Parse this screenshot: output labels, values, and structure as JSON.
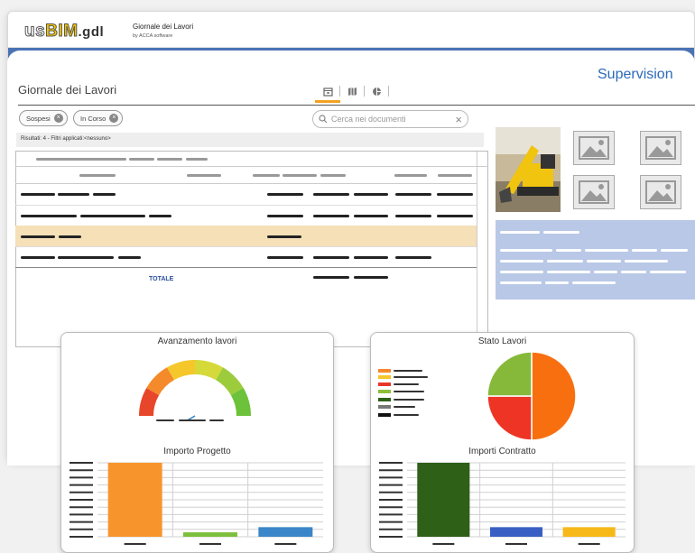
{
  "app": {
    "logo_us": "us",
    "logo_bim": "BIM",
    "logo_gdl": ".gdl",
    "brand_name": "Giornale dei Lavori",
    "brand_sub": "by ACCA software"
  },
  "page": {
    "title": "Giornale dei Lavori",
    "section": "Supervision"
  },
  "tabs": [
    {
      "icon": "calendar-icon",
      "active": true
    },
    {
      "icon": "map-icon",
      "active": false
    },
    {
      "icon": "pie-chart-icon",
      "active": false
    }
  ],
  "filters": {
    "chips": [
      "Sospesi",
      "In Corso"
    ],
    "search_placeholder": "Cerca nei documenti",
    "results_text": "Risultati: 4 - Filtri applicati:<nessuno>"
  },
  "table": {
    "total_label": "TOTALE",
    "highlight_color": "#f5e0b8"
  },
  "cards": {
    "gauge_title": "Avanzamento lavori",
    "stato_title": "Stato Lavori",
    "importo_title": "Importo Progetto",
    "contratti_title": "Importi Contratto"
  },
  "chart_data": [
    {
      "type": "gauge",
      "title": "Avanzamento lavori",
      "value": 0.2,
      "segment_colors": [
        "#e8462a",
        "#f58a2a",
        "#f5c72a",
        "#d6d93a",
        "#9ccc3c",
        "#6cc23a"
      ]
    },
    {
      "type": "pie",
      "title": "Stato Lavori",
      "values": [
        50,
        25,
        25
      ],
      "colors": [
        "#f86f10",
        "#ee3424",
        "#86b93a"
      ]
    },
    {
      "type": "bar",
      "title": "Importo Progetto",
      "values": [
        100,
        6,
        13
      ],
      "colors": [
        "#f7952c",
        "#7cbf3c",
        "#3a86c8"
      ],
      "ylim": [
        0,
        100
      ]
    },
    {
      "type": "bar",
      "title": "Importi Contratto",
      "values": [
        100,
        13,
        13
      ],
      "colors": [
        "#2e6018",
        "#3a5fc4",
        "#f7b919"
      ],
      "ylim": [
        0,
        100
      ]
    }
  ]
}
